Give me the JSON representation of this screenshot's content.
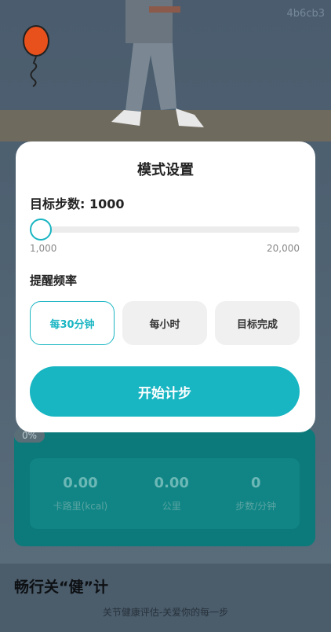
{
  "watermark": "4b6cb3",
  "modal": {
    "title": "模式设置",
    "target_label": "目标步数: 1000",
    "slider": {
      "value": 1000,
      "min": 1000,
      "max": 20000,
      "min_label": "1,000",
      "max_label": "20,000"
    },
    "frequency_label": "提醒频率",
    "frequency_options": [
      {
        "label": "每30分钟",
        "selected": true
      },
      {
        "label": "每小时",
        "selected": false
      },
      {
        "label": "目标完成",
        "selected": false
      }
    ],
    "start_label": "开始计步"
  },
  "progress_badge": "0%",
  "stats": [
    {
      "value": "0.00",
      "label": "卡路里(kcal)"
    },
    {
      "value": "0.00",
      "label": "公里"
    },
    {
      "value": "0",
      "label": "步数/分钟"
    }
  ],
  "footer": {
    "title": "畅行关“健”计",
    "subtitle": "关节健康评估-关爱你的每一步"
  },
  "colors": {
    "accent": "#18b5c2",
    "card": "#0c7a7a",
    "overlay": "#4b5c6b"
  }
}
